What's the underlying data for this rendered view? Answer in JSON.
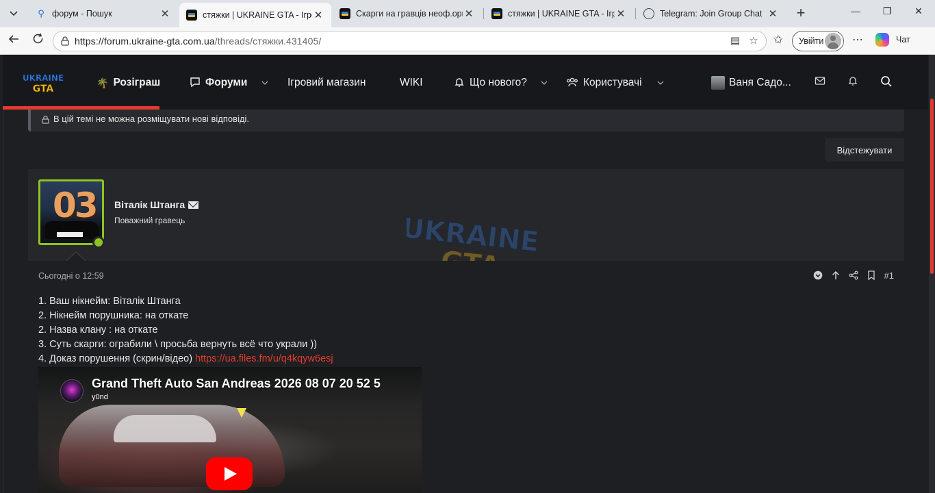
{
  "browser": {
    "tabs": [
      {
        "title": "форум - Пошук",
        "icon": "search-icon"
      },
      {
        "title": "стяжки | UKRAINE GTA - Ігрові",
        "icon": "site-favicon",
        "active": true
      },
      {
        "title": "Скарги на гравців неоф.орган",
        "icon": "site-favicon"
      },
      {
        "title": "стяжки | UKRAINE GTA - Ігрові",
        "icon": "site-favicon"
      },
      {
        "title": "Telegram: Join Group Chat",
        "icon": "globe-icon"
      }
    ],
    "url_host": "https://forum.ukraine-gta.com.ua",
    "url_path": "/threads/стяжки.431405/",
    "signin_label": "Увійти",
    "chat_label": "Чат"
  },
  "site": {
    "logo_line1": "UKRAINE",
    "logo_line2": "GTA",
    "nav": {
      "giveaway": "Розіграш",
      "forums": "Форуми",
      "shop": "Ігровий магазин",
      "wiki": "WIKI",
      "whats_new": "Що нового?",
      "users": "Користувачі",
      "account": "Ваня Садо..."
    }
  },
  "thread": {
    "closed_notice": "В цій темі не можна розміщувати нові відповіді.",
    "watch_label": "Відстежувати"
  },
  "post": {
    "avatar_number": "03",
    "author": "Віталік Штанга",
    "user_title": "Поважний гравець",
    "date": "Сьогодні о 12:59",
    "post_number": "#1",
    "lines": [
      "1. Ваш нікнейм: Віталік Штанга",
      "2. Нікнейм порушника: на откате",
      "2. Назва клану : на откате",
      "3. Суть скарги: ограбили \\ просьба вернуть всё что украли ))",
      "4. Доказ порушення (скрин/відео) "
    ],
    "evidence_link": "https://ua.files.fm/u/q4kqyw6esj",
    "video": {
      "title": "Grand Theft Auto San Andreas 2026 08 07 20 52 5",
      "channel": "y0nd"
    }
  }
}
